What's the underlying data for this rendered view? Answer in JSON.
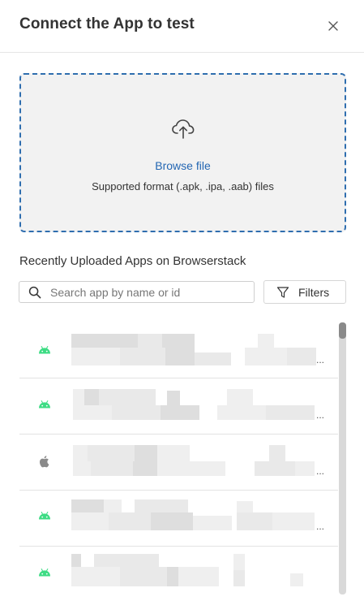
{
  "header": {
    "title": "Connect the App to test",
    "close_icon": "close-icon"
  },
  "upload": {
    "icon": "cloud-upload-icon",
    "browse_label": "Browse file",
    "supported_format": "Supported format (.apk, .ipa, .aab) files"
  },
  "recent": {
    "title": "Recently Uploaded Apps on Browserstack",
    "search": {
      "placeholder": "Search app by name or id",
      "value": "",
      "icon": "search-icon"
    },
    "filters": {
      "label": "Filters",
      "icon": "filter-icon"
    },
    "apps": [
      {
        "platform": "android",
        "icon": "android-icon",
        "ellipsis": "..."
      },
      {
        "platform": "android",
        "icon": "android-icon",
        "ellipsis": "..."
      },
      {
        "platform": "ios",
        "icon": "apple-icon",
        "ellipsis": "..."
      },
      {
        "platform": "android",
        "icon": "android-icon",
        "ellipsis": "..."
      },
      {
        "platform": "android",
        "icon": "android-icon",
        "ellipsis": ""
      }
    ]
  },
  "colors": {
    "accent": "#2467b3",
    "dropzone_border": "#2f6eaf",
    "dropzone_bg": "#f2f2f2",
    "android_green": "#3ddc84",
    "apple_gray": "#8a8a8a"
  }
}
